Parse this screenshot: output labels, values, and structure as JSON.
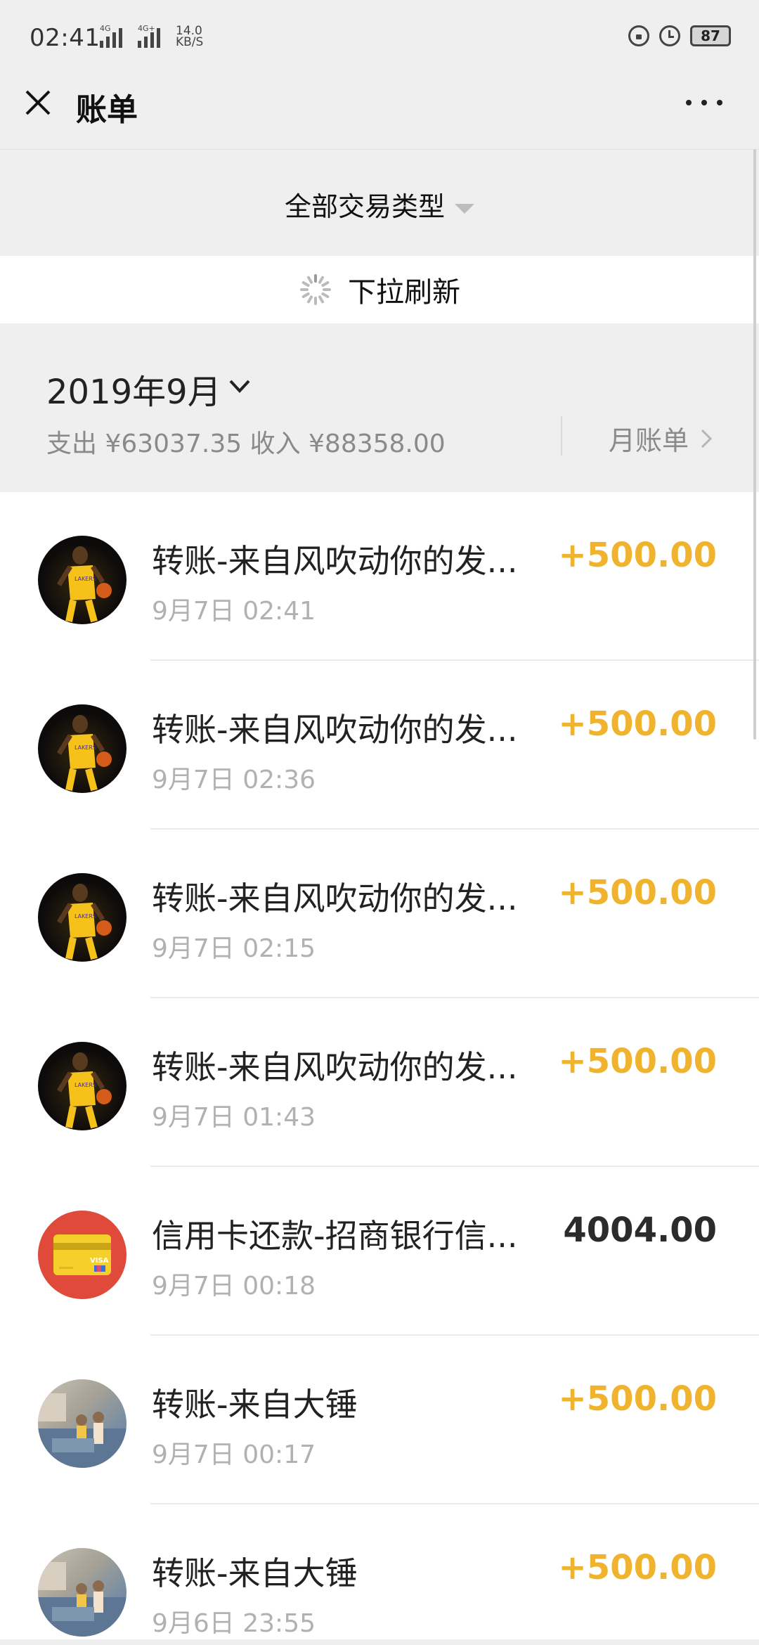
{
  "status_bar": {
    "time": "02:41",
    "signal1_label": "4G",
    "signal2_label": "4G+",
    "net_speed_value": "14.0",
    "net_speed_unit": "KB/S",
    "battery": "87"
  },
  "nav": {
    "title": "账单"
  },
  "filter": {
    "label": "全部交易类型"
  },
  "refresh": {
    "text": "下拉刷新"
  },
  "month": {
    "title": "2019年9月",
    "stats": "支出 ¥63037.35 收入 ¥88358.00",
    "bill_link": "月账单"
  },
  "transactions": [
    {
      "title": "转账-来自风吹动你的发...",
      "time": "9月7日 02:41",
      "amount": "+500.00",
      "type": "income",
      "avatar": "player-avatar"
    },
    {
      "title": "转账-来自风吹动你的发...",
      "time": "9月7日 02:36",
      "amount": "+500.00",
      "type": "income",
      "avatar": "player-avatar"
    },
    {
      "title": "转账-来自风吹动你的发...",
      "time": "9月7日 02:15",
      "amount": "+500.00",
      "type": "income",
      "avatar": "player-avatar"
    },
    {
      "title": "转账-来自风吹动你的发...",
      "time": "9月7日 01:43",
      "amount": "+500.00",
      "type": "income",
      "avatar": "player-avatar"
    },
    {
      "title": "信用卡还款-招商银行信...",
      "time": "9月7日 00:18",
      "amount": "4004.00",
      "type": "expense",
      "avatar": "credit-card-icon"
    },
    {
      "title": "转账-来自大锤",
      "time": "9月7日 00:17",
      "amount": "+500.00",
      "type": "income",
      "avatar": "photo-avatar"
    },
    {
      "title": "转账-来自大锤",
      "time": "9月6日 23:55",
      "amount": "+500.00",
      "type": "income",
      "avatar": "photo-avatar"
    }
  ],
  "colors": {
    "income": "#f0b32d",
    "expense": "#2b2b2b",
    "background": "#ededed"
  }
}
